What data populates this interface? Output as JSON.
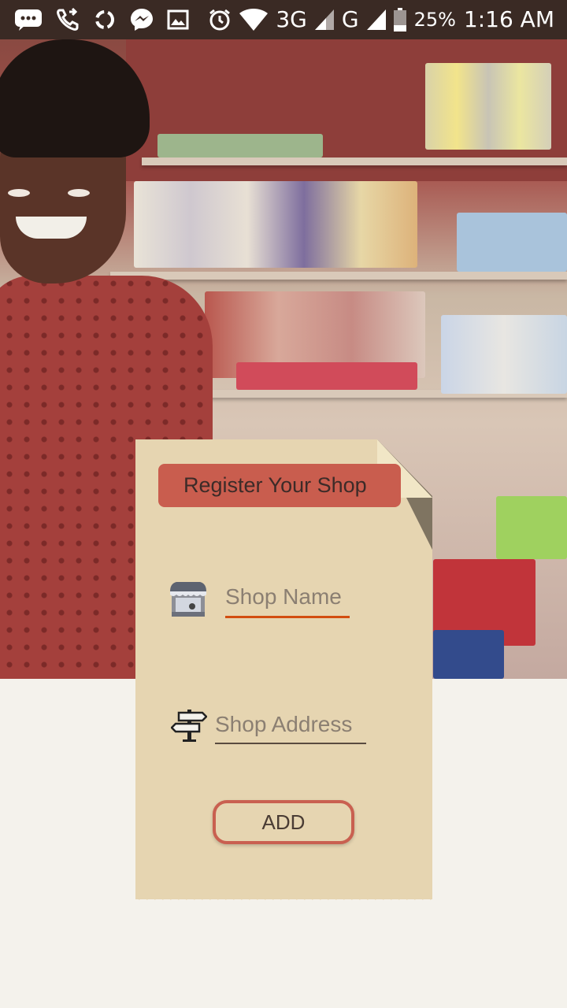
{
  "status_bar": {
    "network_3g": "3G",
    "network_g": "G",
    "battery": "25%",
    "time": "1:16 AM"
  },
  "card": {
    "title": "Register Your Shop",
    "shop_name_placeholder": "Shop Name",
    "shop_address_placeholder": "Shop Address",
    "add_label": "ADD"
  },
  "colors": {
    "ribbon": "#c95d4e",
    "card": "#e6d5b1",
    "active_underline": "#d34d10",
    "status_bar": "#3a2a24",
    "background": "#f4f2ec"
  },
  "icons": [
    "message-icon",
    "call-forward-icon",
    "sync-icon",
    "messenger-icon",
    "image-icon",
    "alarm-icon",
    "wifi-icon",
    "signal-icon",
    "battery-icon",
    "shop-icon",
    "signpost-icon"
  ]
}
